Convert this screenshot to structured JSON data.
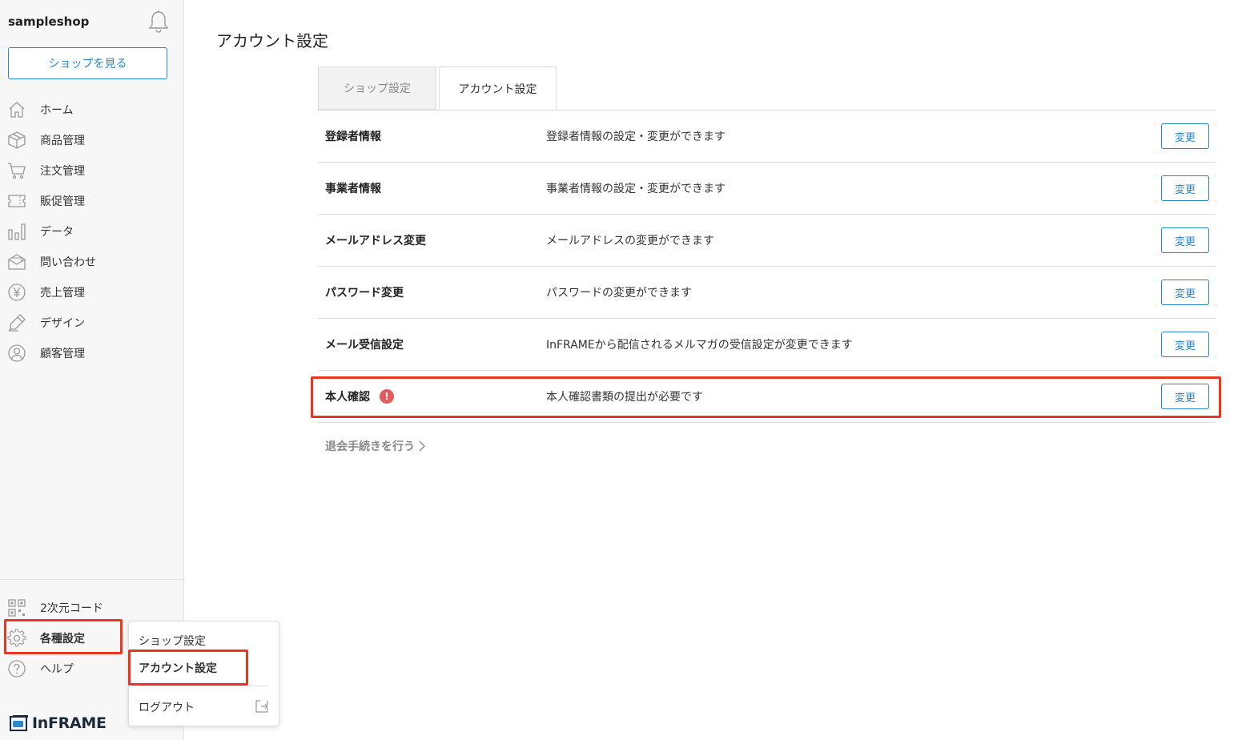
{
  "sidebar": {
    "shop_name": "sampleshop",
    "view_shop_label": "ショップを見る",
    "items": [
      {
        "label": "ホーム",
        "icon": "home-icon"
      },
      {
        "label": "商品管理",
        "icon": "box-icon"
      },
      {
        "label": "注文管理",
        "icon": "cart-icon"
      },
      {
        "label": "販促管理",
        "icon": "ticket-icon"
      },
      {
        "label": "データ",
        "icon": "bar-chart-icon"
      },
      {
        "label": "問い合わせ",
        "icon": "mail-icon"
      },
      {
        "label": "売上管理",
        "icon": "yen-icon"
      },
      {
        "label": "デザイン",
        "icon": "pen-icon"
      },
      {
        "label": "顧客管理",
        "icon": "user-icon"
      }
    ],
    "bottom_items": [
      {
        "label": "2次元コード",
        "icon": "qr-code-icon"
      },
      {
        "label": "各種設定",
        "icon": "gear-icon"
      },
      {
        "label": "ヘルプ",
        "icon": "help-icon"
      }
    ],
    "logo_text": "InFRAME"
  },
  "popup_menu": {
    "items": [
      "ショップ設定",
      "アカウント設定"
    ],
    "logout_label": "ログアウト"
  },
  "main": {
    "title": "アカウント設定",
    "tabs": [
      {
        "label": "ショップ設定",
        "active": false
      },
      {
        "label": "アカウント設定",
        "active": true
      }
    ],
    "rows": [
      {
        "label": "登録者情報",
        "description": "登録者情報の設定・変更ができます",
        "button": "変更"
      },
      {
        "label": "事業者情報",
        "description": "事業者情報の設定・変更ができます",
        "button": "変更"
      },
      {
        "label": "メールアドレス変更",
        "description": "メールアドレスの変更ができます",
        "button": "変更"
      },
      {
        "label": "パスワード変更",
        "description": "パスワードの変更ができます",
        "button": "変更"
      },
      {
        "label": "メール受信設定",
        "description": "InFRAMEから配信されるメルマガの受信設定が変更できます",
        "button": "変更"
      },
      {
        "label": "本人確認",
        "description": "本人確認書類の提出が必要です",
        "button": "変更",
        "alert": "!"
      }
    ],
    "withdraw_label": "退会手続きを行う"
  },
  "colors": {
    "accent": "#2a87c8",
    "highlight": "#e8361f",
    "alert": "#e25c5c"
  }
}
